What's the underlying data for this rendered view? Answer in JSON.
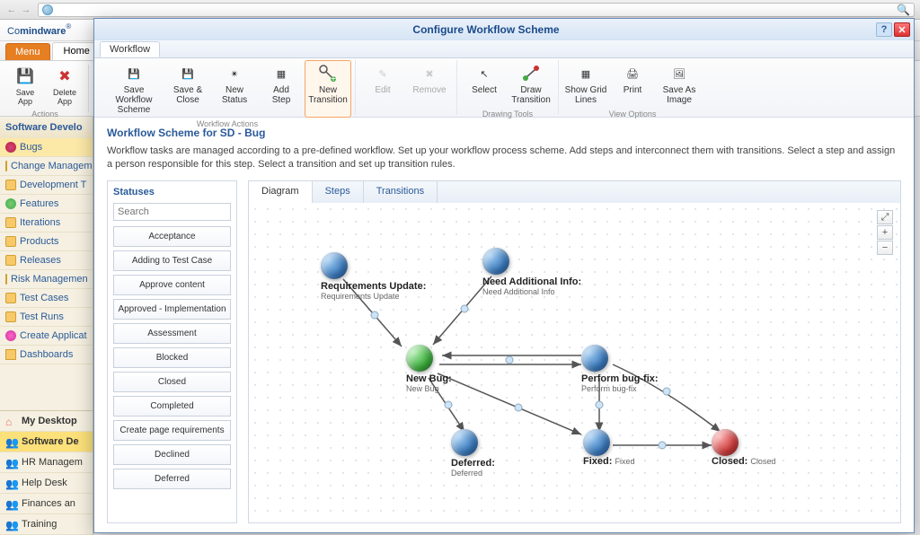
{
  "browser": {
    "search_placeholder": ""
  },
  "app": {
    "logo_a": "Co",
    "logo_b": "mindware",
    "menu": "Menu",
    "home": "Home"
  },
  "ribbon_bg": {
    "save_app": "Save\nApp",
    "delete_app": "Delete\nApp",
    "actions": "Actions"
  },
  "sidebar": {
    "title": "Software Develo",
    "items": [
      "Bugs",
      "Change Managem",
      "Development T",
      "Features",
      "Iterations",
      "Products",
      "Releases",
      "Risk Managemen",
      "Test Cases",
      "Test Runs",
      "Create Applicat",
      "Dashboards"
    ],
    "nav": [
      "My Desktop",
      "Software De",
      "HR Managem",
      "Help Desk",
      "Finances an",
      "Training"
    ]
  },
  "modal": {
    "title": "Configure Workflow Scheme",
    "tab": "Workflow",
    "ribbon": {
      "groups": [
        {
          "caption": "Workflow Actions",
          "buttons": [
            "Save Workflow\nScheme",
            "Save &\nClose",
            "New\nStatus",
            "Add\nStep",
            "New\nTransition"
          ]
        },
        {
          "caption": "",
          "buttons": [
            "Edit",
            "Remove"
          ]
        },
        {
          "caption": "Drawing Tools",
          "buttons": [
            "Select",
            "Draw\nTransition"
          ]
        },
        {
          "caption": "View Options",
          "buttons": [
            "Show Grid\nLines",
            "Print",
            "Save As\nImage"
          ]
        }
      ]
    },
    "scheme_title": "Workflow Scheme for SD - Bug",
    "scheme_desc": "Workflow tasks are managed according to a pre-defined workflow. Set up your workflow process scheme. Add steps and interconnect them with transitions. Select a step and assign a person responsible for this step. Select a transition and set up transition rules.",
    "statuses": {
      "title": "Statuses",
      "search_placeholder": "Search",
      "items": [
        "Acceptance",
        "Adding to Test Case",
        "Approve content",
        "Approved - Implementation",
        "Assessment",
        "Blocked",
        "Closed",
        "Completed",
        "Create page requirements",
        "Declined",
        "Deferred"
      ]
    },
    "diag_tabs": [
      "Diagram",
      "Steps",
      "Transitions"
    ],
    "nodes": {
      "req": {
        "title": "Requirements Update:",
        "sub": "Requirements Update"
      },
      "need": {
        "title": "Need Additional Info:",
        "sub": "Need Additional Info"
      },
      "newbug": {
        "title": "New Bug:",
        "sub": "New Bug"
      },
      "perform": {
        "title": "Perform bug-fix:",
        "sub": "Perform bug-fix"
      },
      "deferred": {
        "title": "Deferred:",
        "sub": "Deferred"
      },
      "fixed": {
        "title": "Fixed:",
        "sub": "Fixed"
      },
      "closed": {
        "title": "Closed:",
        "sub": "Closed"
      }
    }
  }
}
